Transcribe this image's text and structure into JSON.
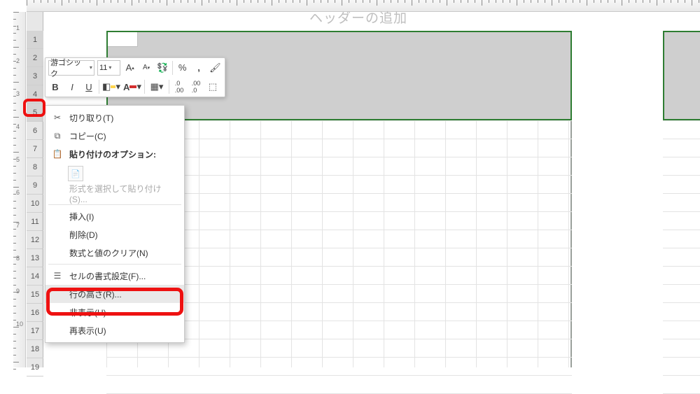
{
  "header_text": "ヘッダーの追加",
  "row_numbers": [
    "1",
    "2",
    "3",
    "4",
    "5",
    "6",
    "7",
    "8",
    "9",
    "10",
    "11",
    "12",
    "13",
    "14",
    "15",
    "16",
    "17",
    "18",
    "19"
  ],
  "selected_rows": [
    "1",
    "2",
    "3",
    "4",
    "5"
  ],
  "mini_toolbar": {
    "font_name": "游ゴシック",
    "font_size": "11",
    "increase_font": "A",
    "decrease_font": "A",
    "bold": "B",
    "italic": "I",
    "underline": "U",
    "percent": "%",
    "comma": ",",
    "decrease_dec": ".0",
    "increase_dec": ".00",
    "accent_color": "#ffd54f",
    "font_color": "#d32f2f"
  },
  "context_menu": {
    "cut": "切り取り(T)",
    "copy": "コピー(C)",
    "paste_options_label": "貼り付けのオプション:",
    "paste_special": "形式を選択して貼り付け(S)...",
    "insert": "挿入(I)",
    "delete": "削除(D)",
    "clear": "数式と値のクリア(N)",
    "format_cells": "セルの書式設定(F)...",
    "row_height": "行の高さ(R)...",
    "hide": "非表示(H)",
    "unhide": "再表示(U)"
  },
  "ruler_left_labels": [
    "1",
    "2",
    "3",
    "4",
    "5",
    "6",
    "7",
    "8",
    "9",
    "10"
  ]
}
